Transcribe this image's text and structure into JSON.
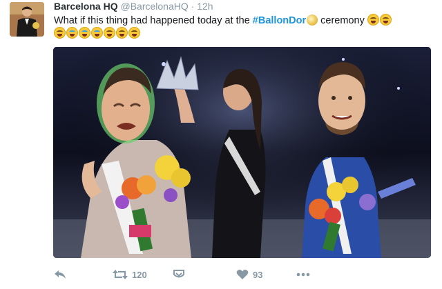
{
  "tweet": {
    "author_name": "Barcelona HQ",
    "author_handle": "@BarcelonaHQ",
    "separator": "·",
    "timestamp": "12h",
    "text_before": "What if this thing had happened today at the ",
    "hashtag": "#BallonDor",
    "text_after": " ceremony",
    "emoji_line1": [
      "joy",
      "joy"
    ],
    "emoji_line2": [
      "joy",
      "sob",
      "sob",
      "sob",
      "joy",
      "joy",
      "joy"
    ]
  },
  "actions": {
    "reply_icon": "reply-icon",
    "retweet_icon": "retweet-icon",
    "retweet_count": "120",
    "save_icon": "bookmark-icon",
    "like_icon": "heart-icon",
    "like_count": "93",
    "more_icon": "more-icon"
  },
  "colors": {
    "hashtag": "#1b95e0",
    "meta_gray": "#8899a6",
    "text": "#14171a"
  }
}
